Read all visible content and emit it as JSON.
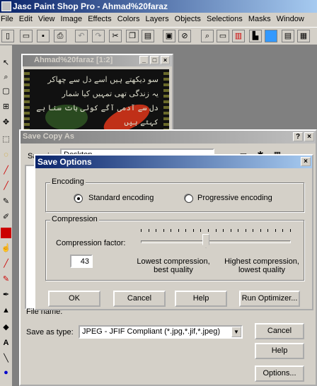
{
  "app": {
    "title": "Jasc Paint Shop Pro - Ahmad%20faraz"
  },
  "menu": [
    "File",
    "Edit",
    "View",
    "Image",
    "Effects",
    "Colors",
    "Layers",
    "Objects",
    "Selections",
    "Masks",
    "Window"
  ],
  "document": {
    "title": "Ahmad%20faraz [1:2]",
    "poem_lines": [
      "سو دیکھتے ہیں اسے دل سے چھاکر",
      "یہ زندگی تھی تمہیں کیا شمار",
      "دل سے آدمی آگے کوئی بات سنا ہے",
      "کہتے ہیں"
    ]
  },
  "save_copy": {
    "title": "Save Copy As",
    "save_in_label": "Save in:",
    "save_in_value": "Desktop",
    "file_name_label": "File name:",
    "save_type_label": "Save as type:",
    "save_type_value": "JPEG - JFIF Compliant (*.jpg,*.jif,*.jpeg)",
    "cancel": "Cancel",
    "help": "Help",
    "options": "Options..."
  },
  "save_options": {
    "title": "Save Options",
    "encoding_label": "Encoding",
    "standard": "Standard encoding",
    "progressive": "Progressive encoding",
    "selected": "standard",
    "compression_label": "Compression",
    "factor_label": "Compression factor:",
    "factor_value": "43",
    "slider_position_percent": 43,
    "low_label_1": "Lowest compression,",
    "low_label_2": "best quality",
    "high_label_1": "Highest compression,",
    "high_label_2": "lowest quality",
    "ok": "OK",
    "cancel": "Cancel",
    "help": "Help",
    "optimizer": "Run Optimizer..."
  },
  "colors": {
    "title_active": "#0a246a",
    "title_inactive": "#808080",
    "face": "#d4d0c8"
  }
}
